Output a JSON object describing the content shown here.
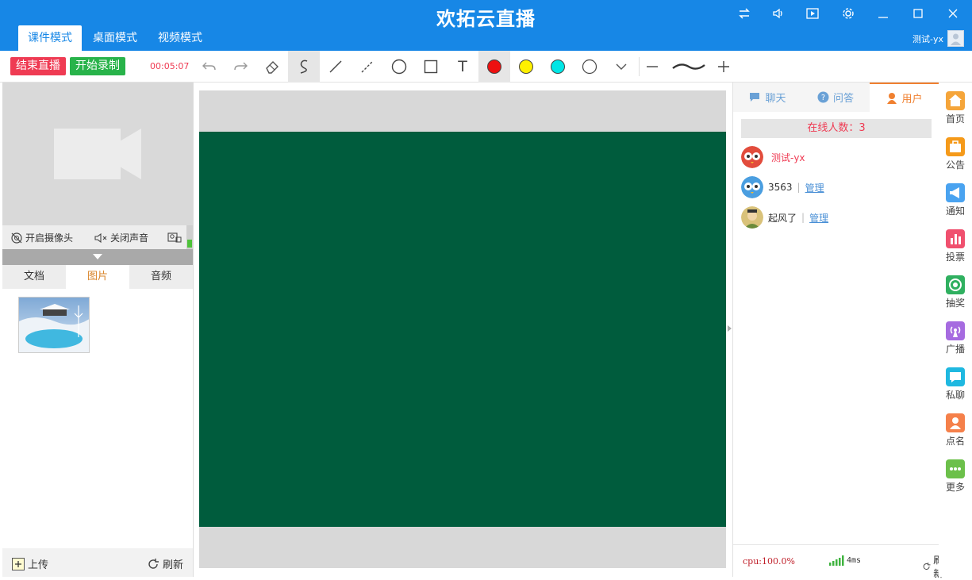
{
  "app": {
    "title": "欢拓云直播"
  },
  "tabs": [
    "课件模式",
    "桌面模式",
    "视频模式"
  ],
  "user": {
    "name": "测试-yx"
  },
  "toolbar": {
    "end_live": "结束直播",
    "start_record": "开始录制",
    "timer": "00:05:07",
    "text_tool": "T",
    "colors": {
      "red": "#ee1010",
      "yellow": "#fff000",
      "cyan": "#00e6e6",
      "white": "#ffffff"
    }
  },
  "camera": {
    "open_camera": "开启摄像头",
    "mute": "关闭声音"
  },
  "resource_tabs": [
    "文档",
    "图片",
    "音频"
  ],
  "left_footer": {
    "upload": "上传",
    "refresh": "刷新"
  },
  "board": {
    "color": "#005c3d"
  },
  "panel_tabs": [
    "聊天",
    "问答",
    "用户"
  ],
  "users": {
    "online_label": "在线人数：3",
    "list": [
      {
        "name": "测试-yx",
        "manage": ""
      },
      {
        "name": "3563",
        "manage": "管理"
      },
      {
        "name": "起风了",
        "manage": "管理"
      }
    ]
  },
  "status": {
    "cpu": "cpu:100.0%",
    "latency": "4ms",
    "refresh": "刷新"
  },
  "side_menu": [
    {
      "label": "首页",
      "icon": "home-icon",
      "color": "#f5a53a"
    },
    {
      "label": "公告",
      "icon": "announcement-icon",
      "color": "#f59a1a"
    },
    {
      "label": "通知",
      "icon": "megaphone-icon",
      "color": "#4aa3f0"
    },
    {
      "label": "投票",
      "icon": "vote-icon",
      "color": "#f0506e"
    },
    {
      "label": "抽奖",
      "icon": "lottery-icon",
      "color": "#30b060"
    },
    {
      "label": "广播",
      "icon": "broadcast-icon",
      "color": "#a66be0"
    },
    {
      "label": "私聊",
      "icon": "private-chat-icon",
      "color": "#1fb8e0"
    },
    {
      "label": "点名",
      "icon": "rollcall-icon",
      "color": "#f5804a"
    },
    {
      "label": "更多",
      "icon": "more-icon",
      "color": "#6cc04a"
    }
  ]
}
